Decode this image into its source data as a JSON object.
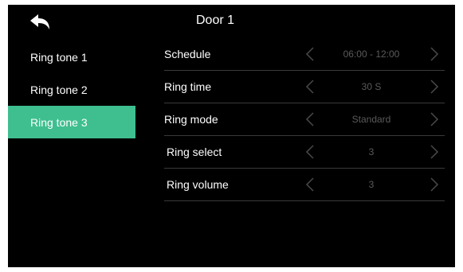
{
  "header": {
    "title": "Door 1"
  },
  "sidebar": {
    "items": [
      {
        "label": "Ring tone 1"
      },
      {
        "label": "Ring tone 2"
      },
      {
        "label": "Ring tone 3"
      }
    ],
    "active_index": 2
  },
  "settings": {
    "rows": [
      {
        "label": "Schedule",
        "value": "06:00 - 12:00"
      },
      {
        "label": "Ring time",
        "value": "30 S"
      },
      {
        "label": "Ring mode",
        "value": "Standard"
      },
      {
        "label": "Ring select",
        "value": "3"
      },
      {
        "label": "Ring volume",
        "value": "3"
      }
    ]
  },
  "icons": {
    "back": "back-arrow-icon",
    "prev": "chevron-left-icon",
    "next": "chevron-right-icon"
  },
  "colors": {
    "background": "#000000",
    "accent": "#3fbf8f",
    "text": "#ffffff",
    "value_text": "#5a5a5a",
    "divider": "#3a3a3a"
  }
}
